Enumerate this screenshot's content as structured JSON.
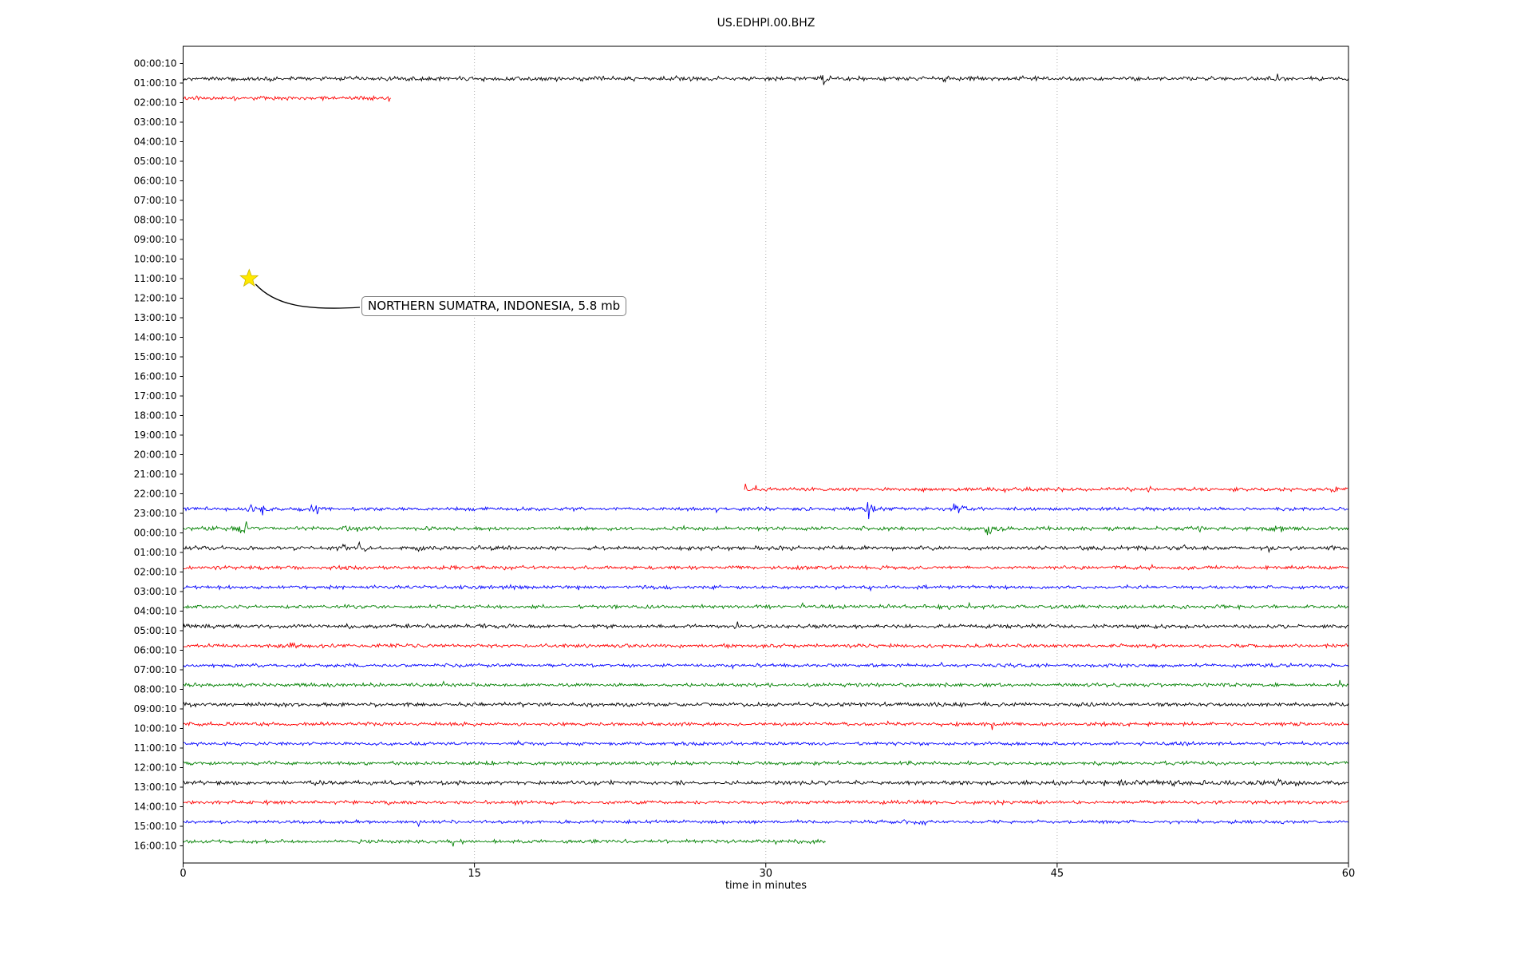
{
  "chart_data": {
    "type": "line",
    "title": "US.EDHPI.00.BHZ",
    "xlabel": "time in minutes",
    "ylabel": "",
    "xlim": [
      0,
      60
    ],
    "x_ticks": [
      0,
      15,
      30,
      45,
      60
    ],
    "grid_minutes": [
      15,
      30,
      45
    ],
    "grid_on": true,
    "grid_color": "#b0b0b0",
    "colors": {
      "black": "#000000",
      "red": "#ff0000",
      "blue": "#0000ff",
      "green": "#008000"
    },
    "row_labels": [
      "00:00:10",
      "01:00:10",
      "02:00:10",
      "03:00:10",
      "04:00:10",
      "05:00:10",
      "06:00:10",
      "07:00:10",
      "08:00:10",
      "09:00:10",
      "10:00:10",
      "11:00:10",
      "12:00:10",
      "13:00:10",
      "14:00:10",
      "15:00:10",
      "16:00:10",
      "17:00:10",
      "18:00:10",
      "19:00:10",
      "20:00:10",
      "21:00:10",
      "22:00:10",
      "23:00:10",
      "00:00:10",
      "01:00:10",
      "02:00:10",
      "03:00:10",
      "04:00:10",
      "05:00:10",
      "06:00:10",
      "07:00:10",
      "08:00:10",
      "09:00:10",
      "10:00:10",
      "11:00:10",
      "12:00:10",
      "13:00:10",
      "14:00:10",
      "15:00:10",
      "16:00:10"
    ],
    "traces": [
      {
        "row": 1,
        "label": "01:00:10",
        "color": "black",
        "start_min": 0,
        "end_min": 60,
        "amp": 1.15,
        "bursts": [
          [
            25,
            0.5,
            0.7
          ],
          [
            33,
            0.45,
            1.8
          ],
          [
            39.3,
            0.12,
            1.4
          ]
        ]
      },
      {
        "row": 2,
        "label": "02:00:10",
        "color": "red",
        "start_min": 0,
        "end_min": 10.7,
        "amp": 1.05,
        "bursts": []
      },
      {
        "row": 22,
        "label": "22:00:10",
        "color": "red",
        "start_min": 28.9,
        "end_min": 60,
        "amp": 1.0,
        "bursts": [
          [
            28.98,
            0.06,
            6
          ],
          [
            29.3,
            0.3,
            1.2
          ],
          [
            43,
            1.2,
            0.35
          ],
          [
            59.3,
            0.12,
            2.2
          ]
        ]
      },
      {
        "row": 23,
        "label": "23:00:10",
        "color": "blue",
        "start_min": 0,
        "end_min": 60,
        "amp": 0.95,
        "bursts": [
          [
            3.8,
            0.7,
            1.6
          ],
          [
            4.1,
            0.15,
            2.5
          ],
          [
            6.5,
            0.35,
            1.8
          ],
          [
            6.9,
            0.1,
            2.2
          ],
          [
            35.3,
            0.12,
            4.5
          ],
          [
            35.5,
            0.5,
            1.2
          ],
          [
            39.7,
            0.12,
            4.2
          ],
          [
            40.1,
            0.4,
            1.5
          ]
        ]
      },
      {
        "row": 24,
        "label": "00:00:10",
        "color": "green",
        "start_min": 0,
        "end_min": 60,
        "amp": 1.05,
        "bursts": [
          [
            3.0,
            0.3,
            1.8
          ],
          [
            3.2,
            0.08,
            2.5
          ],
          [
            8.8,
            0.4,
            1.6
          ],
          [
            9.0,
            0.1,
            2.2
          ],
          [
            41.5,
            0.15,
            3.2
          ],
          [
            41.8,
            0.5,
            0.8
          ],
          [
            48,
            0.5,
            0.4
          ],
          [
            52.5,
            0.8,
            0.5
          ],
          [
            56.5,
            0.9,
            0.6
          ]
        ]
      },
      {
        "row": 25,
        "label": "01:00:10",
        "color": "black",
        "start_min": 0,
        "end_min": 60,
        "amp": 1.1,
        "bursts": [
          [
            8.3,
            0.2,
            1.4
          ],
          [
            9.1,
            0.25,
            2.6
          ],
          [
            12.2,
            0.2,
            0.8
          ]
        ]
      },
      {
        "row": 26,
        "label": "02:00:10",
        "color": "red",
        "start_min": 0,
        "end_min": 60,
        "amp": 1.0,
        "bursts": [
          [
            8.5,
            0.3,
            0.5
          ],
          [
            36.2,
            0.4,
            0.7
          ],
          [
            49.8,
            0.4,
            0.6
          ],
          [
            57.5,
            0.3,
            0.8
          ]
        ]
      },
      {
        "row": 27,
        "label": "03:00:10",
        "color": "blue",
        "start_min": 0,
        "end_min": 60,
        "amp": 0.95,
        "bursts": [
          [
            17,
            0.4,
            0.4
          ]
        ]
      },
      {
        "row": 28,
        "label": "04:00:10",
        "color": "green",
        "start_min": 0,
        "end_min": 60,
        "amp": 1.0,
        "bursts": []
      },
      {
        "row": 29,
        "label": "05:00:10",
        "color": "black",
        "start_min": 0,
        "end_min": 60,
        "amp": 1.1,
        "bursts": [
          [
            8.5,
            0.07,
            2.2
          ]
        ]
      },
      {
        "row": 30,
        "label": "06:00:10",
        "color": "red",
        "start_min": 0,
        "end_min": 60,
        "amp": 1.0,
        "bursts": [
          [
            5.4,
            0.35,
            1.5
          ],
          [
            5.6,
            0.1,
            1.0
          ]
        ]
      },
      {
        "row": 31,
        "label": "07:00:10",
        "color": "blue",
        "start_min": 0,
        "end_min": 60,
        "amp": 0.95,
        "bursts": []
      },
      {
        "row": 32,
        "label": "08:00:10",
        "color": "green",
        "start_min": 0,
        "end_min": 60,
        "amp": 1.0,
        "bursts": []
      },
      {
        "row": 33,
        "label": "09:00:10",
        "color": "black",
        "start_min": 0,
        "end_min": 60,
        "amp": 1.1,
        "bursts": [
          [
            8.4,
            0.07,
            2.0
          ],
          [
            21,
            0.3,
            0.5
          ]
        ]
      },
      {
        "row": 34,
        "label": "10:00:10",
        "color": "red",
        "start_min": 0,
        "end_min": 60,
        "amp": 1.0,
        "bursts": []
      },
      {
        "row": 35,
        "label": "11:00:10",
        "color": "blue",
        "start_min": 0,
        "end_min": 60,
        "amp": 0.95,
        "bursts": []
      },
      {
        "row": 36,
        "label": "12:00:10",
        "color": "green",
        "start_min": 0,
        "end_min": 60,
        "amp": 1.0,
        "bursts": []
      },
      {
        "row": 37,
        "label": "13:00:10",
        "color": "black",
        "start_min": 0,
        "end_min": 60,
        "amp": 1.1,
        "bursts": [
          [
            50,
            3.5,
            0.45
          ],
          [
            57,
            1.5,
            0.5
          ]
        ]
      },
      {
        "row": 38,
        "label": "14:00:10",
        "color": "red",
        "start_min": 0,
        "end_min": 60,
        "amp": 1.0,
        "bursts": [
          [
            3.0,
            0.15,
            1.3
          ]
        ]
      },
      {
        "row": 39,
        "label": "15:00:10",
        "color": "blue",
        "start_min": 0,
        "end_min": 60,
        "amp": 0.95,
        "bursts": [
          [
            37,
            2.0,
            0.3
          ]
        ]
      },
      {
        "row": 40,
        "label": "16:00:10",
        "color": "green",
        "start_min": 0,
        "end_min": 33.1,
        "amp": 1.0,
        "bursts": [
          [
            9,
            0.4,
            0.4
          ]
        ]
      }
    ],
    "event": {
      "row": 11,
      "row_label": "11:00:10",
      "minute": 3.4,
      "marker": "star",
      "marker_color": "#ffe900",
      "text": "NORTHERN SUMATRA, INDONESIA, 5.8 mb"
    }
  }
}
